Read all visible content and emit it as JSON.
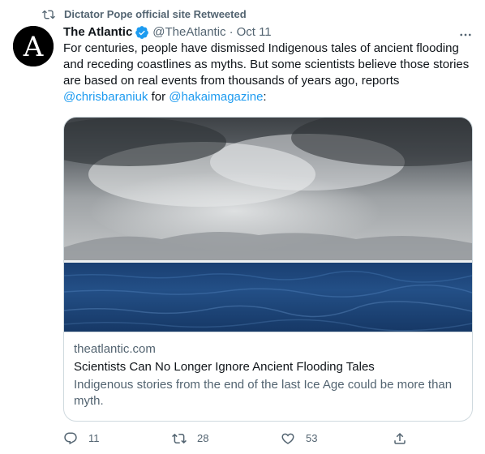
{
  "retweet_banner": {
    "text": "Dictator Pope official site Retweeted",
    "icon": "retweet-icon"
  },
  "author": {
    "name": "The Atlantic",
    "handle": "@TheAtlantic",
    "separator": "·",
    "date": "Oct 11",
    "avatar_letter": "A",
    "verified_icon": "verified-badge-icon"
  },
  "tweet": {
    "text_before": "For centuries, people have dismissed Indigenous tales of ancient flooding and receding coastlines as myths. But some scientists believe those stories are based on real events from thousands of years ago, reports ",
    "mention_1": "@chrisbaraniuk",
    "connector": " for ",
    "mention_2": "@hakaimagazine",
    "suffix": ":"
  },
  "card": {
    "image_alt": "Storm clouds over a deep blue sea with sunlight breaking through",
    "domain": "theatlantic.com",
    "title": "Scientists Can No Longer Ignore Ancient Flooding Tales",
    "description": "Indigenous stories from the end of the last Ice Age could be more than myth."
  },
  "actions": {
    "reply_count": "11",
    "retweet_count": "28",
    "like_count": "53",
    "reply_icon": "reply-icon",
    "retweet_icon": "retweet-icon",
    "like_icon": "heart-icon",
    "share_icon": "share-icon"
  },
  "colors": {
    "link": "#1d9bf0",
    "secondary_text": "#536471",
    "primary_text": "#0f1419",
    "border": "#cfd9de"
  }
}
